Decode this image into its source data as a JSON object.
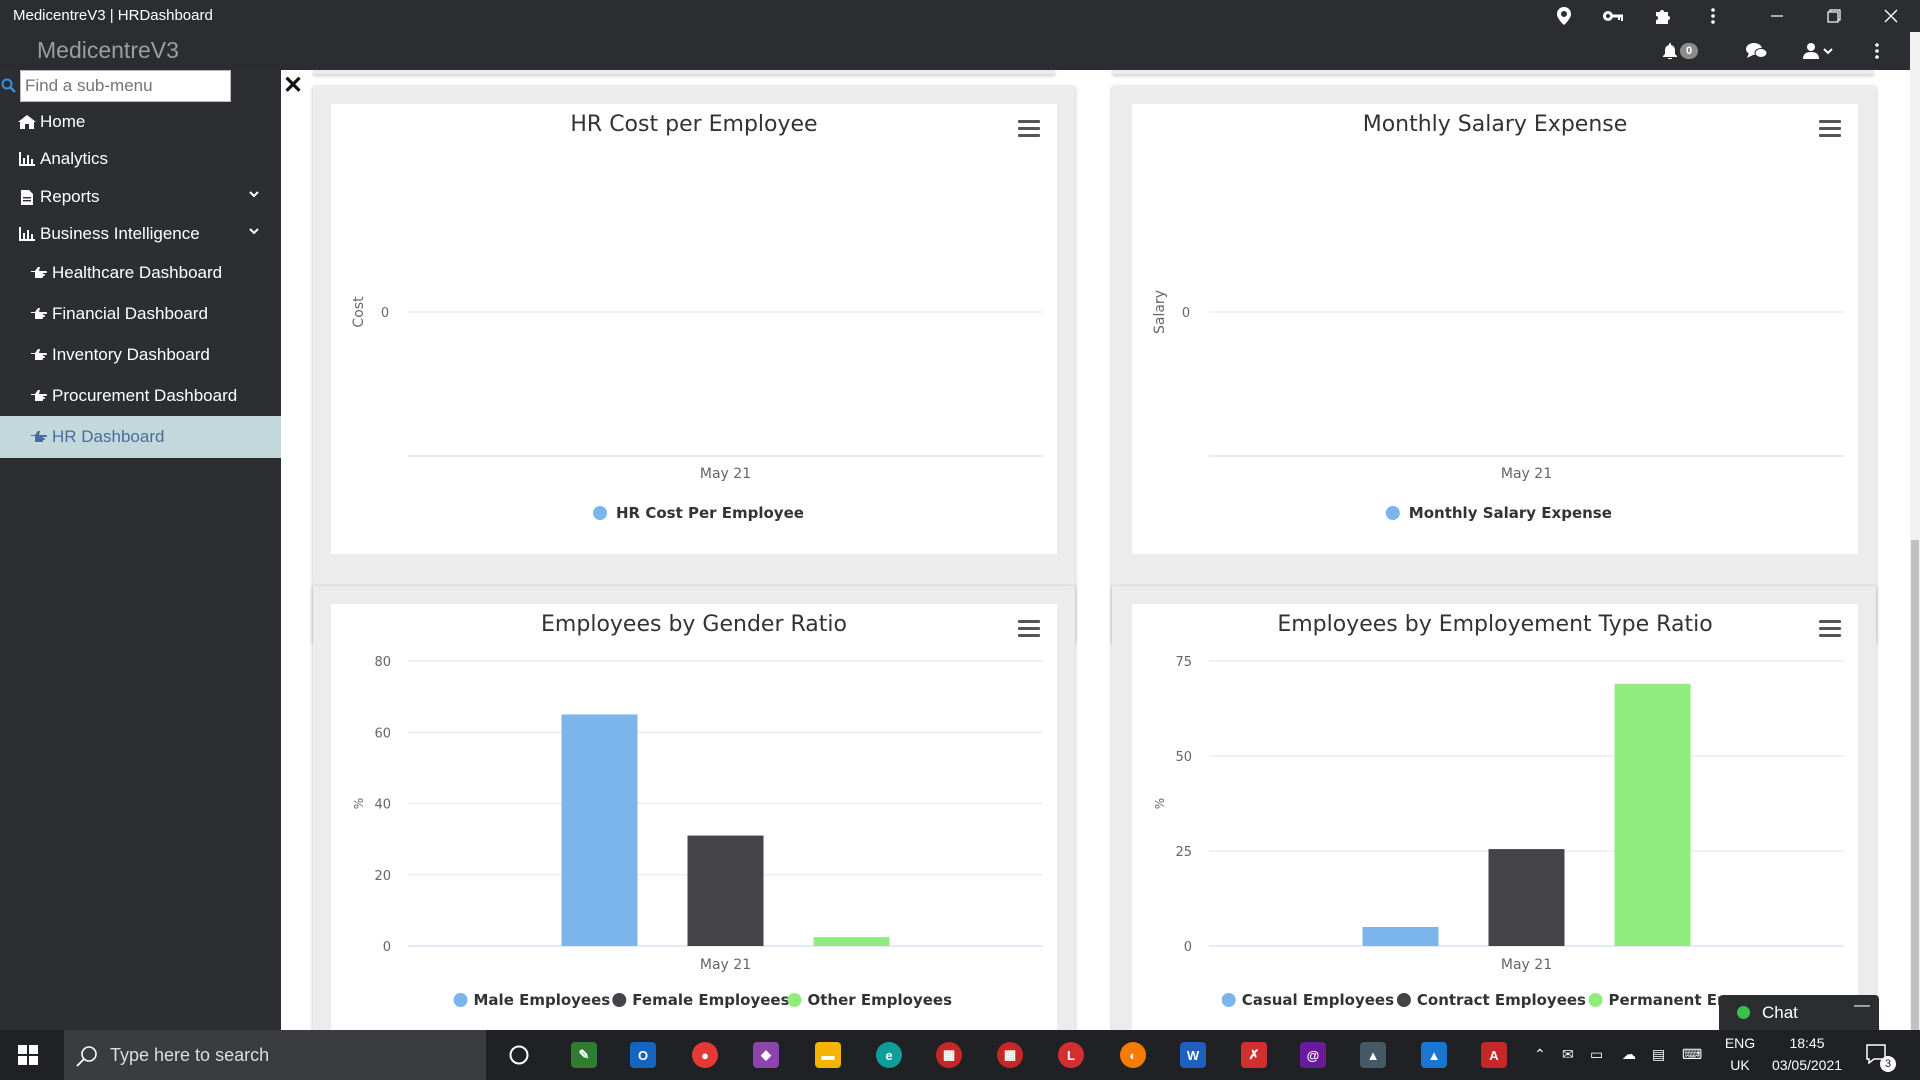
{
  "window": {
    "title": "MedicentreV3 | HRDashboard",
    "icons": [
      "location-icon",
      "key-icon",
      "puzzle-icon",
      "kebab-icon",
      "minimize-icon",
      "restore-icon",
      "close-icon"
    ]
  },
  "header": {
    "brand": "MedicentreV3",
    "notification_count": "0"
  },
  "sidebar": {
    "search_placeholder": "Find a sub-menu",
    "items": [
      {
        "label": "Home",
        "icon": "home-icon"
      },
      {
        "label": "Analytics",
        "icon": "chart-icon"
      },
      {
        "label": "Reports",
        "icon": "file-icon",
        "expandable": true
      },
      {
        "label": "Business Intelligence",
        "icon": "chart-icon",
        "expandable": true
      },
      {
        "label": "Healthcare Dashboard",
        "icon": "hand-pointer-icon"
      },
      {
        "label": "Financial Dashboard",
        "icon": "hand-pointer-icon"
      },
      {
        "label": "Inventory Dashboard",
        "icon": "hand-pointer-icon"
      },
      {
        "label": "Procurement Dashboard",
        "icon": "hand-pointer-icon"
      },
      {
        "label": "HR Dashboard",
        "icon": "hand-pointer-icon",
        "active": true
      }
    ]
  },
  "chart_data": [
    {
      "type": "line",
      "title": "HR Cost per Employee",
      "ylabel": "Cost",
      "xlabel": "",
      "categories": [
        "May 21"
      ],
      "yticks": [
        "0"
      ],
      "series": [
        {
          "name": "HR Cost Per Employee",
          "values": [],
          "color": "#7cb5ec"
        }
      ]
    },
    {
      "type": "line",
      "title": "Monthly Salary Expense",
      "ylabel": "Salary",
      "xlabel": "",
      "categories": [
        "May 21"
      ],
      "yticks": [
        "0"
      ],
      "series": [
        {
          "name": "Monthly Salary Expense",
          "values": [],
          "color": "#7cb5ec"
        }
      ]
    },
    {
      "type": "bar",
      "title": "Employees by Gender Ratio",
      "ylabel": "%",
      "xlabel": "",
      "categories": [
        "May 21"
      ],
      "ylim": [
        0,
        80
      ],
      "yticks": [
        0,
        20,
        40,
        60,
        80
      ],
      "series": [
        {
          "name": "Male Employees",
          "values": [
            65
          ],
          "color": "#7cb5ec"
        },
        {
          "name": "Female Employees",
          "values": [
            31
          ],
          "color": "#434348"
        },
        {
          "name": "Other Employees",
          "values": [
            2.5
          ],
          "color": "#90ed7d"
        }
      ]
    },
    {
      "type": "bar",
      "title": "Employees by Employement Type Ratio",
      "ylabel": "%",
      "xlabel": "",
      "categories": [
        "May 21"
      ],
      "ylim": [
        0,
        75
      ],
      "yticks": [
        0,
        25,
        50,
        75
      ],
      "series": [
        {
          "name": "Casual Employees",
          "values": [
            5
          ],
          "color": "#7cb5ec"
        },
        {
          "name": "Contract Employees",
          "values": [
            25.5
          ],
          "color": "#434348"
        },
        {
          "name": "Permanent Employees",
          "values": [
            69
          ],
          "color": "#90ed7d"
        }
      ]
    }
  ],
  "legend_overlap": {
    "permanent_visible_text": "Permanent En"
  },
  "chat": {
    "label": "Chat"
  },
  "taskbar": {
    "search_placeholder": "Type here to search",
    "lang_top": "ENG",
    "lang_bottom": "UK",
    "time": "18:45",
    "date": "03/05/2021",
    "notification_count": "3"
  }
}
